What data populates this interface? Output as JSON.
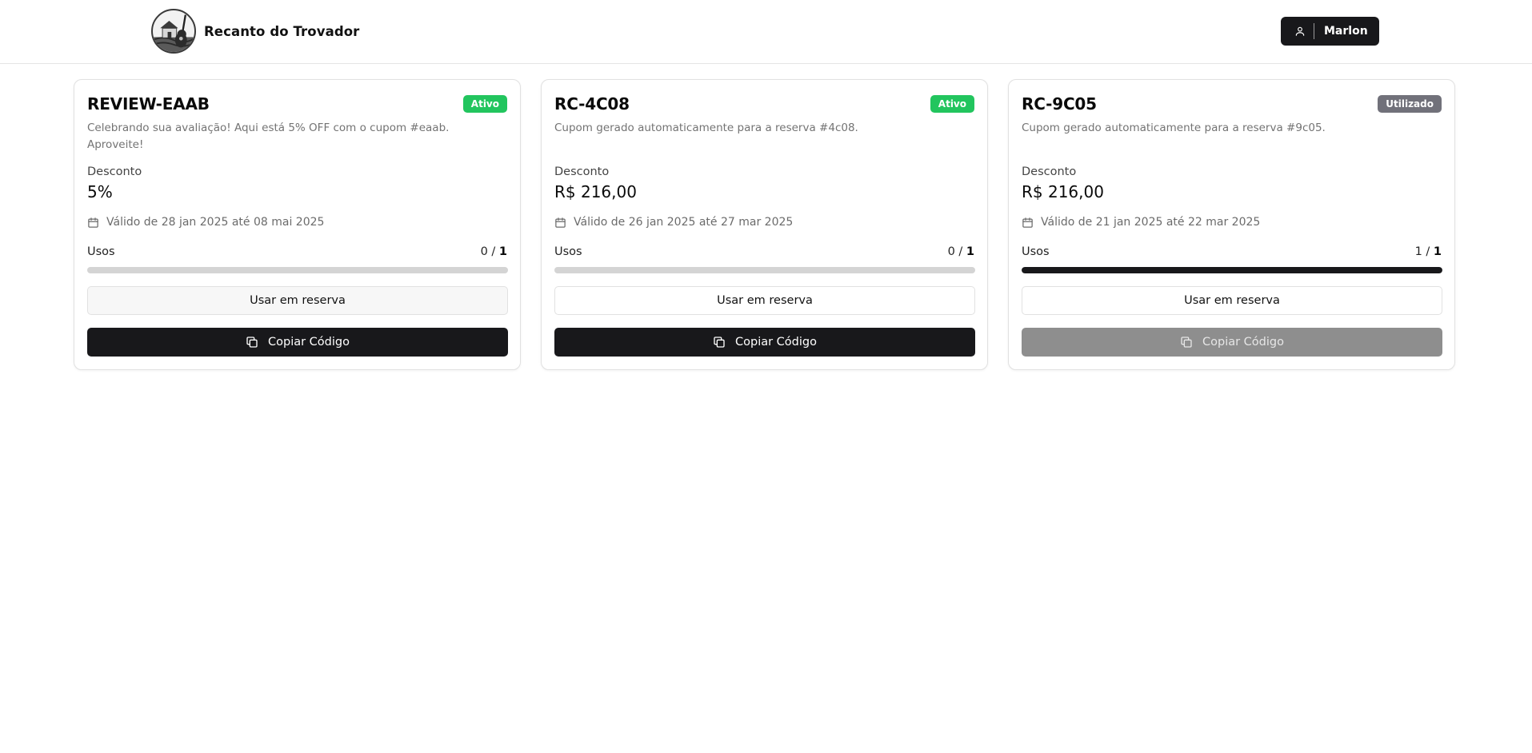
{
  "header": {
    "brand_name": "Recanto do Trovador",
    "logo_icon": "guitar-farmhouse-logo",
    "user": {
      "name": "Marlon",
      "icon": "user-icon"
    }
  },
  "colors": {
    "active_badge": "#22c55e",
    "used_badge": "#71717a",
    "primary_dark": "#18181b",
    "disabled_button": "#8e8e8e"
  },
  "coupons": [
    {
      "code": "REVIEW-EAAB",
      "status": "Ativo",
      "status_color": "#22c55e",
      "description": "Celebrando sua avaliação! Aqui está 5% OFF com o cupom #eaab. Aproveite!",
      "discount_label": "Desconto",
      "discount_value": "5%",
      "validity": "Válido de 28 jan 2025 até 08 mai 2025",
      "uses_label": "Usos",
      "uses_used": "0",
      "uses_sep": " / ",
      "uses_total": "1",
      "usage_fraction": 0,
      "use_button": "Usar em reserva",
      "copy_button": "Copiar Código",
      "copy_disabled": false
    },
    {
      "code": "RC-4C08",
      "status": "Ativo",
      "status_color": "#22c55e",
      "description": "Cupom gerado automaticamente para a reserva #4c08.",
      "discount_label": "Desconto",
      "discount_value": "R$ 216,00",
      "validity": "Válido de 26 jan 2025 até 27 mar 2025",
      "uses_label": "Usos",
      "uses_used": "0",
      "uses_sep": " / ",
      "uses_total": "1",
      "usage_fraction": 0,
      "use_button": "Usar em reserva",
      "copy_button": "Copiar Código",
      "copy_disabled": false
    },
    {
      "code": "RC-9C05",
      "status": "Utilizado",
      "status_color": "#71717a",
      "description": "Cupom gerado automaticamente para a reserva #9c05.",
      "discount_label": "Desconto",
      "discount_value": "R$ 216,00",
      "validity": "Válido de 21 jan 2025 até 22 mar 2025",
      "uses_label": "Usos",
      "uses_used": "1",
      "uses_sep": " / ",
      "uses_total": "1",
      "usage_fraction": 1,
      "use_button": "Usar em reserva",
      "copy_button": "Copiar Código",
      "copy_disabled": true
    }
  ]
}
